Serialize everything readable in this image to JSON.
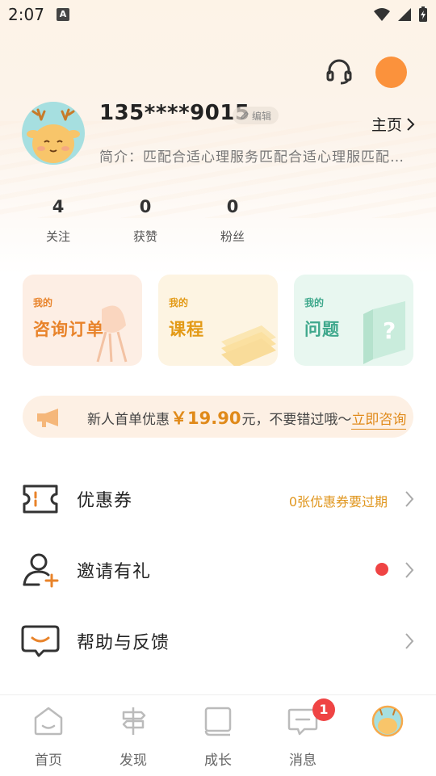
{
  "status_bar": {
    "time": "2:07",
    "a_icon": "A"
  },
  "profile": {
    "phone": "135****9015",
    "edit_label": "编辑",
    "homepage_label": "主页",
    "bio": "简介：匹配合适心理服务匹配合适心理服匹配…"
  },
  "stats": [
    {
      "value": "4",
      "label": "关注"
    },
    {
      "value": "0",
      "label": "获赞"
    },
    {
      "value": "0",
      "label": "粉丝"
    }
  ],
  "cards": [
    {
      "small": "我的",
      "big": "咨询订单",
      "color": "#e8832a",
      "bg": "#fdeee4"
    },
    {
      "small": "我的",
      "big": "课程",
      "color": "#e39a16",
      "bg": "#fdf4e2"
    },
    {
      "small": "我的",
      "big": "问题",
      "color": "#3fa88c",
      "bg": "#e8f7f0"
    }
  ],
  "promo": {
    "prefix": "新人首单优惠",
    "price": "￥19.90",
    "suffix": "元，不要错过哦～",
    "link": "立即咨询"
  },
  "menu": {
    "coupon": {
      "label": "优惠券",
      "note": "0张优惠券要过期"
    },
    "invite": {
      "label": "邀请有礼"
    },
    "help": {
      "label": "帮助与反馈"
    }
  },
  "tabs": [
    {
      "label": "首页",
      "icon": "home-icon"
    },
    {
      "label": "发现",
      "icon": "signpost-icon"
    },
    {
      "label": "成长",
      "icon": "book-icon"
    },
    {
      "label": "消息",
      "icon": "message-icon",
      "badge": "1"
    }
  ],
  "colors": {
    "accent": "#e08a1a",
    "orange": "#fb923c",
    "red": "#ef4444"
  }
}
